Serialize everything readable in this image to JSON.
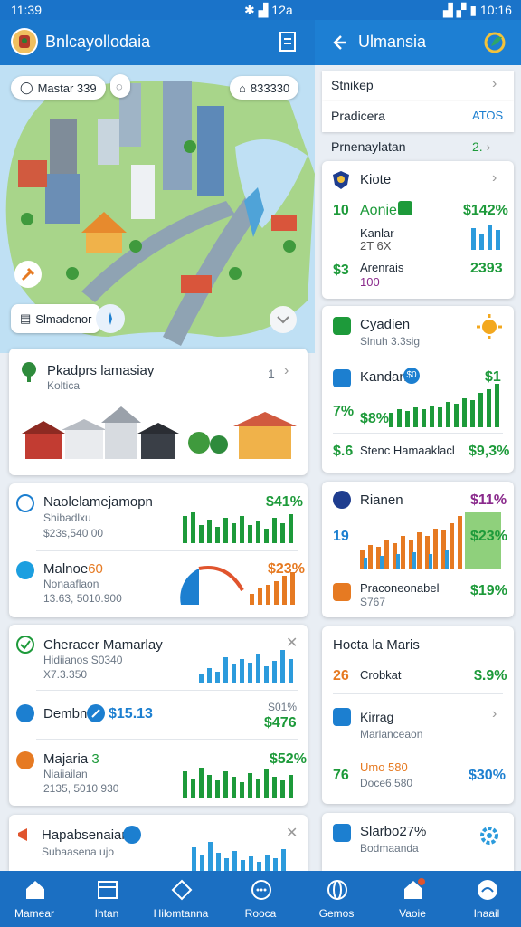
{
  "status": {
    "time_left": "11:39",
    "signal_left": "12a",
    "time_right": "10:16"
  },
  "left_header": {
    "title": "Bnlcayollodaia"
  },
  "right_header": {
    "title": "Ulmansia"
  },
  "map": {
    "pill_top_left": "Mastar 339",
    "pill_top_right": "833330",
    "pill_bottom_left": "Slmadcnor"
  },
  "places_card": {
    "title": "Pkadprs lamasiay",
    "subtitle": "Koltica",
    "count": "1"
  },
  "stats_card_1": {
    "row1": {
      "title": "Naolelamejamopn",
      "line1": "Shibadlxu",
      "line2": "$23s,540 00",
      "value": "$41%"
    },
    "row2": {
      "title": "Malnoe",
      "tag": "60",
      "line1": "Nonaaflaon",
      "line2": "13.63, 5010.900",
      "value": "$23%"
    }
  },
  "stats_card_2": {
    "row1": {
      "title": "Cheracer Mamarlay",
      "line1": "Hidiianos S0340",
      "line2": "X7.3.350"
    },
    "row2": {
      "title": "Dembn",
      "value": "$15.13",
      "side_top": "S01%",
      "side_value": "$476"
    },
    "row3": {
      "title": "Majaria",
      "num": "3",
      "line1": "Niaiiailan",
      "line2": "2135, 5010 930",
      "value": "$52%"
    }
  },
  "stats_card_3": {
    "title": "Hapabsenaian",
    "line1": "Subaasena ujo"
  },
  "right": {
    "list": [
      {
        "label": "Stnikep",
        "value": ""
      },
      {
        "label": "Pradicera",
        "value": "ATOS"
      },
      {
        "label": "Prnenaylatan",
        "value": "2."
      }
    ],
    "kiote_card": {
      "title": "Kiote",
      "rows": [
        {
          "lead": "10",
          "label": "Aonie",
          "value": "$142%"
        },
        {
          "lead": "",
          "label": "Kanlar",
          "sub": "2T 6X",
          "value": ""
        },
        {
          "lead": "$3",
          "label": "Arenrais",
          "sub": "100",
          "value": "2393"
        }
      ]
    },
    "cyadien_card": {
      "title": "Cyadien",
      "subtitle": "Slnuh 3.3sig",
      "row2": {
        "lead": "7%",
        "title": "Kandan",
        "badge": "$0",
        "value": "$1",
        "pct": "$8%"
      },
      "row3": {
        "lead": "$.6",
        "label": "Stenc Hamaaklacl",
        "value": "$9,3%"
      }
    },
    "rianen_card": {
      "title": "Rianen",
      "value": "$11%",
      "lead": "19",
      "chart_label": "$23%",
      "row2": {
        "title": "Praconeonabel",
        "sub": "S767",
        "value": "$19%"
      }
    },
    "hocta_card": {
      "title": "Hocta la Maris",
      "row1": {
        "lead": "26",
        "label": "Crobkat",
        "value": "$.9%"
      },
      "row2": {
        "title": "Kirrag",
        "sub": "Marlanceaon"
      },
      "row3": {
        "lead": "76",
        "label": "Umo 580",
        "sub": "Doce6.580",
        "value": "$30%"
      }
    },
    "slarbo_card": {
      "title": "Slarbo27%",
      "sub": "Bodmaanda"
    }
  },
  "nav": [
    {
      "label": "Mamear",
      "icon": "home-icon"
    },
    {
      "label": "Ihtan",
      "icon": "calendar-icon"
    },
    {
      "label": "Hilomtanna",
      "icon": "map-icon"
    },
    {
      "label": "Rooca",
      "icon": "chat-icon"
    },
    {
      "label": "Gemos",
      "icon": "globe-icon"
    },
    {
      "label": "Vaoie",
      "icon": "home-alert-icon"
    },
    {
      "label": "Inaail",
      "icon": "message-icon"
    }
  ],
  "colors": {
    "primary": "#1b78cc",
    "green": "#1d9a3a",
    "orange": "#e67a22",
    "blue": "#1c7fd0"
  }
}
